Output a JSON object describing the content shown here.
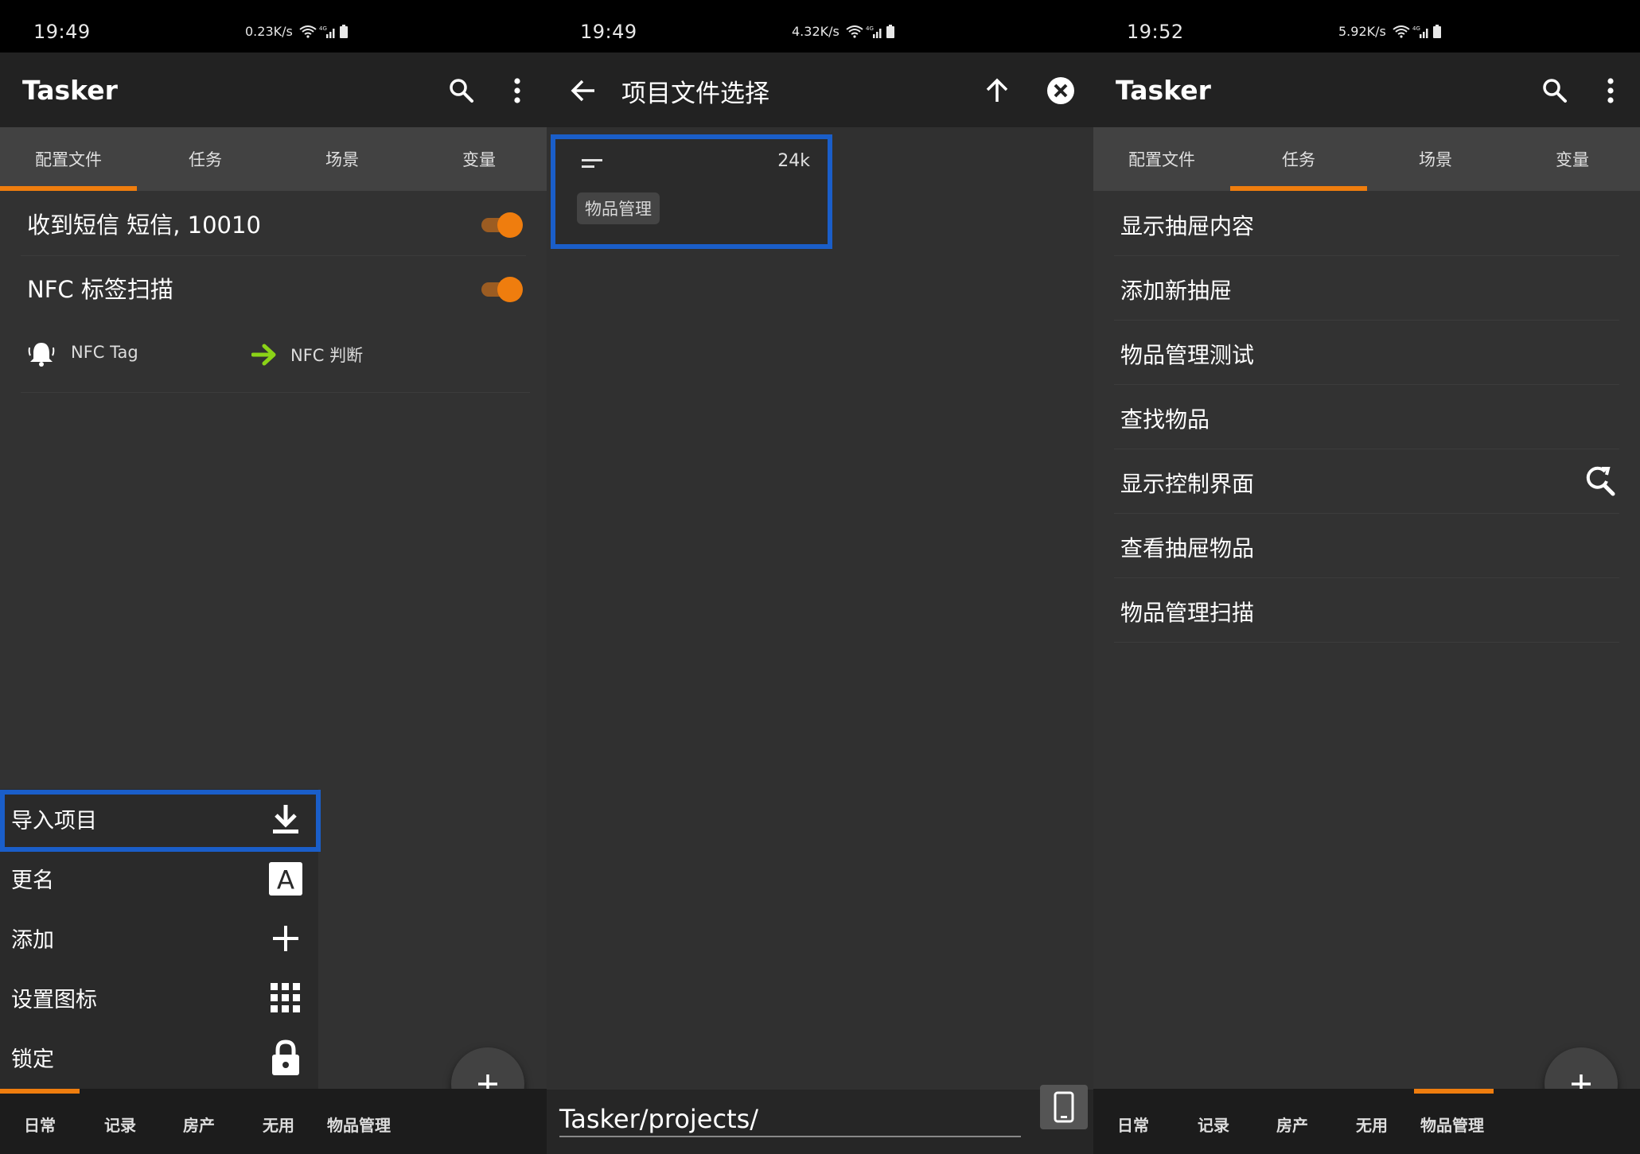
{
  "colors": {
    "accent": "#ef7d0e",
    "highlight": "#1a5ec9",
    "appbar": "#222222",
    "tabbar": "#424242",
    "background": "#323232"
  },
  "panel1": {
    "status": {
      "time": "19:49",
      "speed": "0.23K/s",
      "net": "4G"
    },
    "title": "Tasker",
    "tabs": [
      "配置文件",
      "任务",
      "场景",
      "变量"
    ],
    "active_tab": 0,
    "profiles": [
      {
        "label": "收到短信 短信, 10010",
        "enabled": true
      },
      {
        "label": "NFC 标签扫描",
        "enabled": true
      }
    ],
    "context": {
      "trigger": "NFC Tag",
      "task": "NFC 判断"
    },
    "menu": [
      {
        "label": "导入项目",
        "icon": "download-icon"
      },
      {
        "label": "更名",
        "icon": "letter-a-icon"
      },
      {
        "label": "添加",
        "icon": "plus-icon"
      },
      {
        "label": "设置图标",
        "icon": "grid-icon"
      },
      {
        "label": "锁定",
        "icon": "lock-icon"
      }
    ],
    "projects": [
      "日常",
      "记录",
      "房产",
      "无用",
      "物品管理"
    ],
    "active_project": 0
  },
  "panel2": {
    "status": {
      "time": "19:49",
      "speed": "4.32K/s",
      "net": "4G"
    },
    "title": "项目文件选择",
    "file": {
      "size": "24k",
      "name": "物品管理"
    },
    "path": "Tasker/projects/"
  },
  "panel3": {
    "status": {
      "time": "19:52",
      "speed": "5.92K/s",
      "net": "4G"
    },
    "title": "Tasker",
    "tabs": [
      "配置文件",
      "任务",
      "场景",
      "变量"
    ],
    "active_tab": 1,
    "tasks": [
      "显示抽屉内容",
      "添加新抽屉",
      "物品管理测试",
      "查找物品",
      "显示控制界面",
      "查看抽屉物品",
      "物品管理扫描"
    ],
    "projects": [
      "日常",
      "记录",
      "房产",
      "无用",
      "物品管理"
    ],
    "active_project": 4
  }
}
